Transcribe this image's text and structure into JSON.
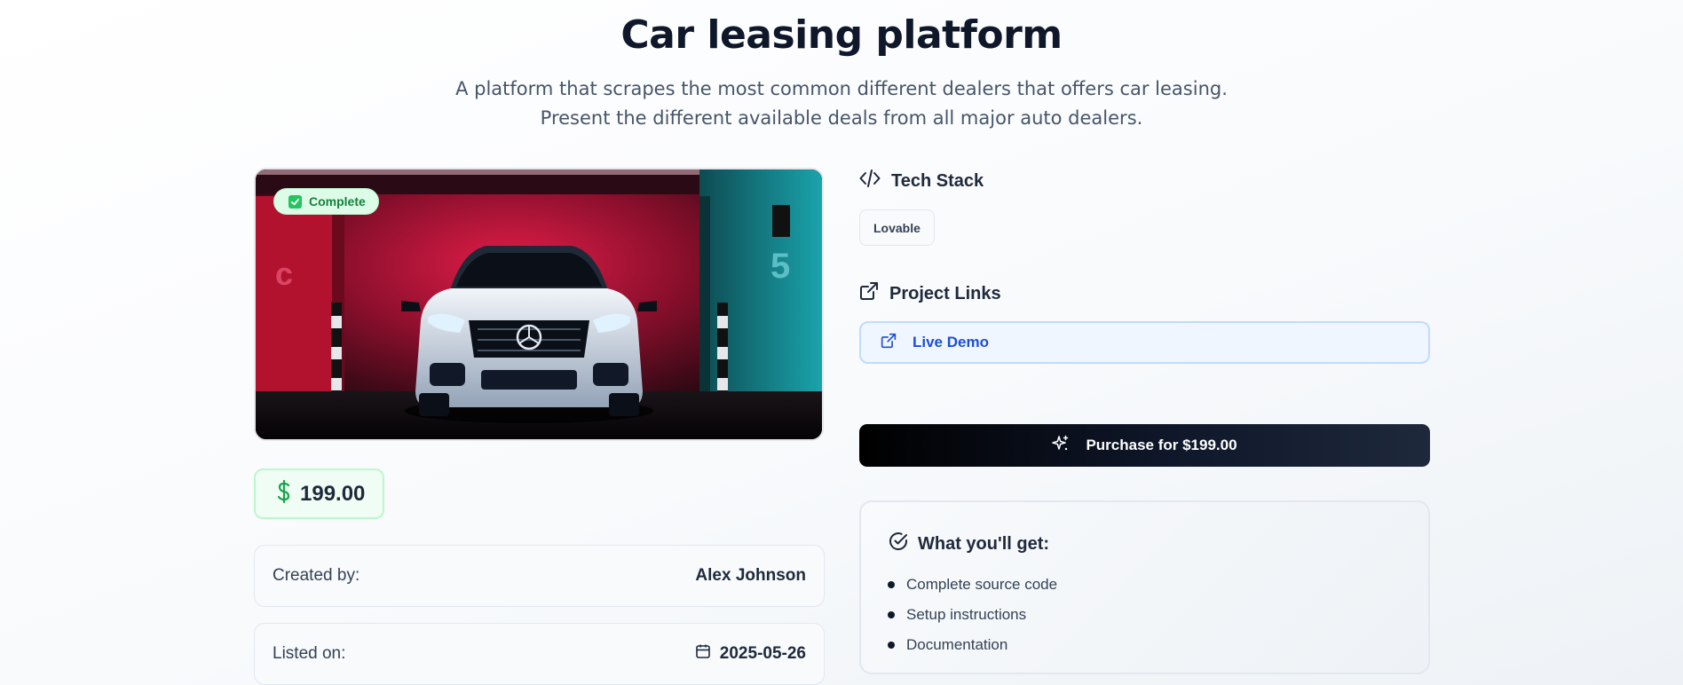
{
  "header": {
    "title": "Car leasing platform",
    "description": "A platform that scrapes the most common different dealers that offers car leasing. Present the different available deals from all major auto dealers."
  },
  "project": {
    "status": "Complete",
    "price": "199.00",
    "created_by_label": "Created by:",
    "created_by_value": "Alex Johnson",
    "listed_on_label": "Listed on:",
    "listed_on_value": "2025-05-26"
  },
  "tech_stack": {
    "heading": "Tech Stack",
    "items": [
      "Lovable"
    ]
  },
  "links": {
    "heading": "Project Links",
    "live_demo": "Live Demo"
  },
  "purchase": {
    "label": "Purchase for $199.00"
  },
  "benefits": {
    "heading": "What you'll get:",
    "items": [
      "Complete source code",
      "Setup instructions",
      "Documentation"
    ]
  },
  "icons": {
    "status": "check-square-icon",
    "price": "dollar-icon",
    "date": "calendar-icon",
    "tech_stack": "code-icon",
    "project_links": "external-link-icon",
    "purchase": "sparkles-icon",
    "benefits": "check-circle-icon"
  },
  "colors": {
    "accent_green": "#16a34a",
    "link_blue": "#1d4ed8",
    "button_dark": "#0f172a"
  }
}
